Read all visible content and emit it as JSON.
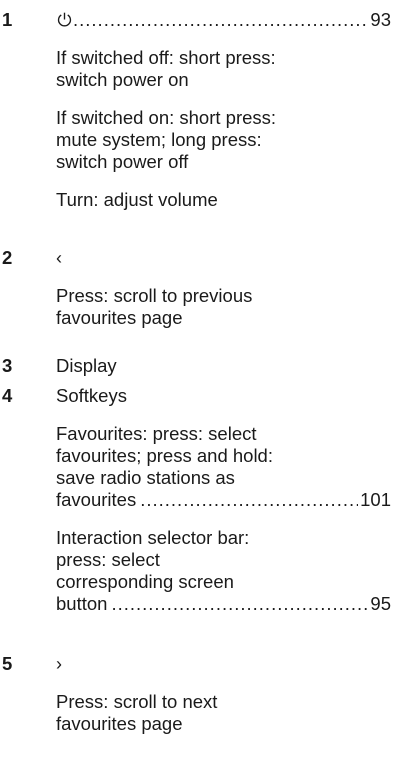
{
  "items": [
    {
      "number": "1",
      "entries": [
        {
          "icon": "power-icon",
          "page_ref": "93"
        },
        {
          "lines": [
            "If switched off: short press:",
            "switch power on"
          ]
        },
        {
          "lines": [
            "If switched on: short press:",
            "mute system; long press:",
            "switch power off"
          ]
        },
        {
          "lines": [
            "Turn: adjust volume"
          ]
        }
      ]
    },
    {
      "number": "2",
      "symbol": "‹",
      "icon": "chevron-left-icon",
      "entries": [
        {
          "lines": [
            "Press: scroll to previous",
            "favourites page"
          ]
        }
      ]
    },
    {
      "number": "3",
      "label": "Display"
    },
    {
      "number": "4",
      "label": "Softkeys",
      "entries": [
        {
          "lines": [
            "Favourites: press: select",
            "favourites; press and hold:",
            "save radio stations as"
          ],
          "last_line": "favourites",
          "page_ref": "101"
        },
        {
          "lines": [
            "Interaction selector bar:",
            "press: select",
            "corresponding screen"
          ],
          "last_line": "button",
          "page_ref": "95"
        }
      ]
    },
    {
      "number": "5",
      "symbol": "›",
      "icon": "chevron-right-icon",
      "entries": [
        {
          "lines": [
            "Press: scroll to next",
            "favourites page"
          ]
        }
      ]
    }
  ]
}
